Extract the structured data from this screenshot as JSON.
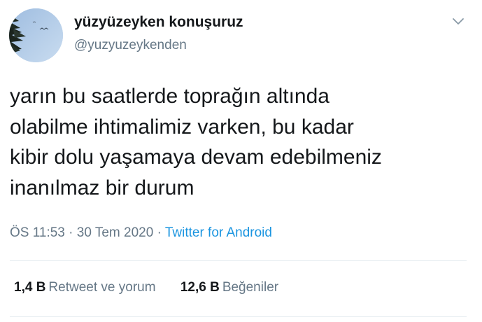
{
  "author": {
    "display_name": "yüzyüzeyken konuşuruz",
    "handle": "@yuzyuzeykenden",
    "avatar_icon": "palm-leaf-avatar"
  },
  "tweet": {
    "text": "yarın bu saatlerde toprağın altında\nolabilme ihtimalimiz varken, bu kadar\nkibir dolu yaşamaya devam edebilmeniz\ninanılmaz bir durum",
    "time": "ÖS 11:53",
    "sep1": "·",
    "date": "30 Tem 2020",
    "sep2": "·",
    "source": "Twitter for Android"
  },
  "stats": {
    "retweets_count": "1,4 B",
    "retweets_label": "Retweet ve yorum",
    "likes_count": "12,6 B",
    "likes_label": "Beğeniler"
  },
  "colors": {
    "link": "#1b95e0",
    "muted": "#657786",
    "text": "#14171a",
    "divider": "#e6ecf0"
  },
  "icons": {
    "menu": "chevron-down-icon"
  }
}
